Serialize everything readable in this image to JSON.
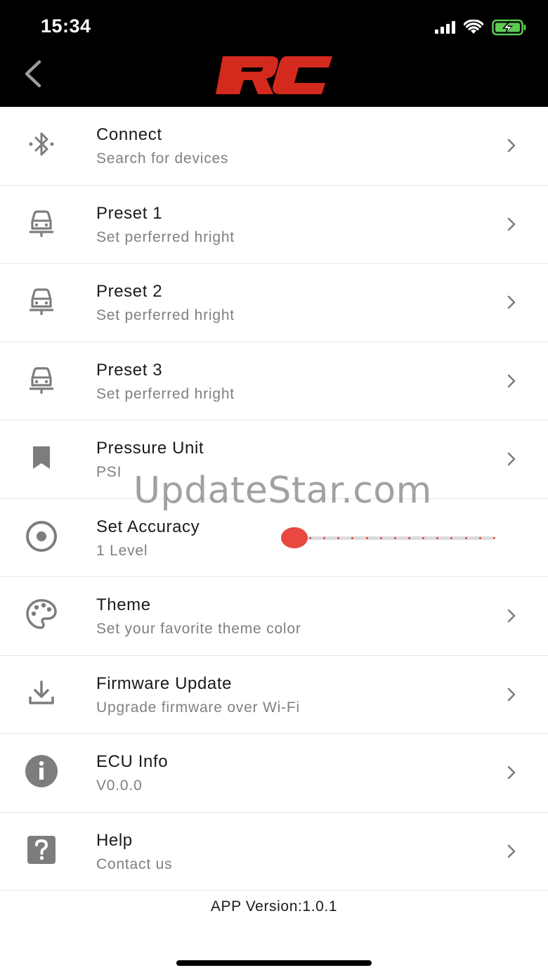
{
  "status_bar": {
    "time": "15:34"
  },
  "header": {
    "logo_text": "RC",
    "colors": {
      "background": "#000000",
      "logo": "#d42a1e"
    }
  },
  "menu": [
    {
      "title": "Connect",
      "subtitle": "Search for devices",
      "icon": "bluetooth-icon"
    },
    {
      "title": "Preset 1",
      "subtitle": "Set perferred hright",
      "icon": "car-lift-icon"
    },
    {
      "title": "Preset 2",
      "subtitle": "Set perferred hright",
      "icon": "car-lift-icon"
    },
    {
      "title": "Preset 3",
      "subtitle": "Set perferred hright",
      "icon": "car-lift-icon"
    },
    {
      "title": "Pressure Unit",
      "subtitle": "PSI",
      "icon": "bookmark-icon"
    },
    {
      "title": "Set Accuracy",
      "subtitle": "1 Level",
      "icon": "target-icon",
      "slider_value": 0
    },
    {
      "title": "Theme",
      "subtitle": "Set your favorite theme color",
      "icon": "palette-icon"
    },
    {
      "title": "Firmware Update",
      "subtitle": "Upgrade firmware over Wi-Fi",
      "icon": "download-icon"
    },
    {
      "title": "ECU Info",
      "subtitle": "V0.0.0",
      "icon": "info-icon"
    },
    {
      "title": "Help",
      "subtitle": "Contact us",
      "icon": "help-icon"
    }
  ],
  "app_version": "APP Version:1.0.1",
  "watermark": "UpdateStar.com",
  "accent_color": "#e8483f"
}
